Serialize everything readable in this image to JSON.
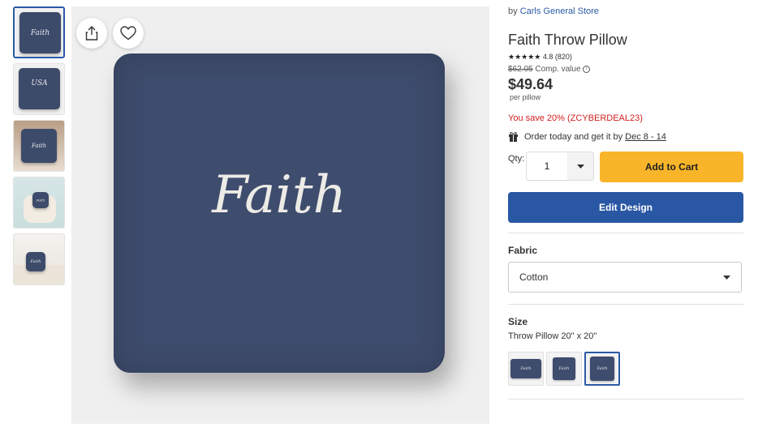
{
  "thumbnails": [
    {
      "text": "Faith",
      "scene": "plain"
    },
    {
      "text": "USA",
      "scene": "plain"
    },
    {
      "text": "Faith",
      "scene": "bed"
    },
    {
      "text": "Faith",
      "scene": "chair"
    },
    {
      "text": "Faith",
      "scene": "sofa"
    }
  ],
  "main_image": {
    "pillow_text": "Faith",
    "share_icon": "share-icon",
    "favorite_icon": "heart-icon"
  },
  "product": {
    "by_prefix": "by",
    "store": "Carls General Store",
    "title": "Faith Throw Pillow",
    "stars": "★★★★★",
    "rating": "4.8 (820)",
    "comp_price": "$62.05",
    "comp_label": "Comp. value",
    "price": "$49.64",
    "per": "per pillow",
    "savings": "You save 20% (ZCYBERDEAL23)",
    "order_text": "Order today and get it by",
    "delivery_date": "Dec 8 - 14"
  },
  "quantity": {
    "label": "Qty:",
    "value": "1"
  },
  "buttons": {
    "add_to_cart": "Add to Cart",
    "edit_design": "Edit Design"
  },
  "fabric": {
    "label": "Fabric",
    "selected": "Cotton"
  },
  "size": {
    "label": "Size",
    "selected": "Throw Pillow 20\" x 20\"",
    "options": [
      {
        "text": "Faith",
        "shape": "lumbar"
      },
      {
        "text": "Faith",
        "shape": "small-square"
      },
      {
        "text": "Faith",
        "shape": "square"
      }
    ]
  },
  "colors": {
    "navy": "#3e4c6d",
    "accent_blue": "#2957a4",
    "cart_yellow": "#f9b52a",
    "sale_red": "#d32020"
  }
}
